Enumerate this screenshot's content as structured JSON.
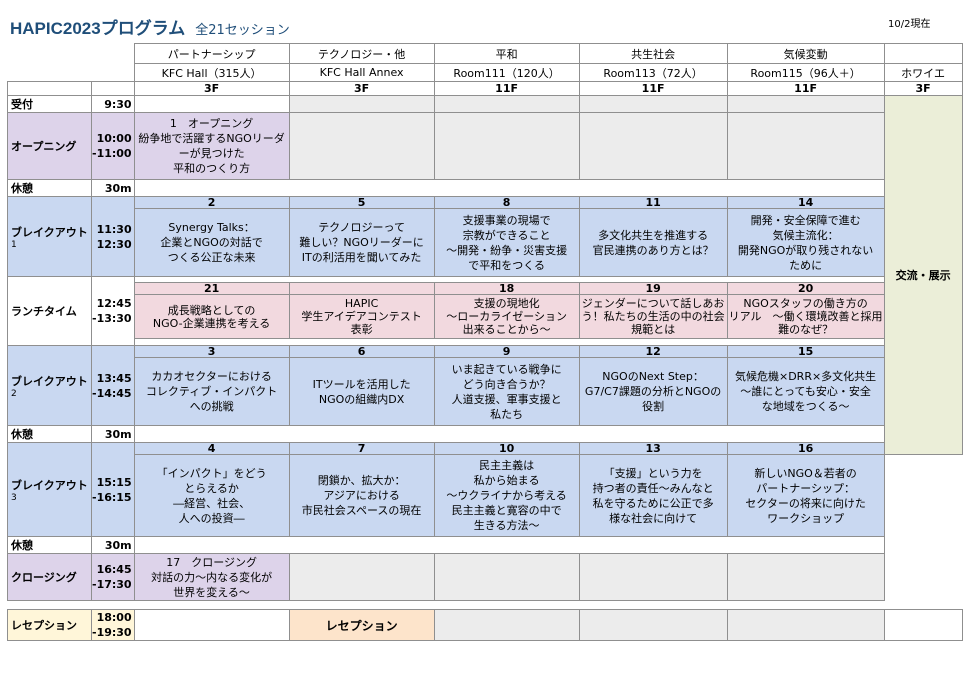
{
  "header": {
    "title": "HAPIC2023プログラム",
    "subtitle": "全21セッション",
    "as_of": "10/2現在"
  },
  "tracks": [
    {
      "name": "パートナーシップ",
      "room": "KFC Hall（315人）",
      "floor": "3F"
    },
    {
      "name": "テクノロジー・他",
      "room": "KFC Hall Annex",
      "floor": "3F"
    },
    {
      "name": "平和",
      "room": "Room111（120人）",
      "floor": "11F"
    },
    {
      "name": "共生社会",
      "room": "Room113（72人）",
      "floor": "11F"
    },
    {
      "name": "気候変動",
      "room": "Room115（96人＋）",
      "floor": "11F"
    },
    {
      "name": "",
      "room": "ホワイエ",
      "floor": "3F"
    }
  ],
  "foyer": "交流・展示",
  "rows": {
    "reception_desk": {
      "label": "受付",
      "time": "9:30"
    },
    "opening": {
      "label": "オープニング",
      "time1": "10:00",
      "time2": "-11:00",
      "session": "1　オープニング\n紛争地で活躍するNGOリーダーが見つけた\n平和のつくり方"
    },
    "break1": {
      "label": "休憩",
      "time": "30m"
    },
    "breakout1": {
      "label": "ブレイクアウト",
      "sub": "1",
      "time1": "11:30",
      "time2": "12:30",
      "sessions": [
        {
          "num": "2",
          "title": "Synergy Talks：\n企業とNGOの対話で\nつくる公正な未来"
        },
        {
          "num": "5",
          "title": "テクノロジーって\n難しい？NGOリーダーに\nITの利活用を聞いてみた"
        },
        {
          "num": "8",
          "title": "支援事業の現場で\n宗教ができること\n～開発・紛争・災害支援\nで平和をつくる"
        },
        {
          "num": "11",
          "title": "多文化共生を推進する\n官民連携のあり方とは？"
        },
        {
          "num": "14",
          "title": "開発・安全保障で進む\n気候主流化：\n開発NGOが取り残されない\nために"
        }
      ]
    },
    "lunch": {
      "label": "ランチタイム",
      "time1": "12:45",
      "time2": "-13:30",
      "sessions": [
        {
          "num": "21",
          "title": "成長戦略としての\nNGO-企業連携を考える"
        },
        {
          "num": "",
          "title": "HAPIC\n学生アイデアコンテスト\n表彰"
        },
        {
          "num": "18",
          "title": "支援の現地化\n～ローカライゼーション\n出来ることから～"
        },
        {
          "num": "19",
          "title": "ジェンダーについて話しあおう！私たちの生活の中の社会規範とは"
        },
        {
          "num": "20",
          "title": "NGOスタッフの働き方の\nリアル　～働く環境改善と採用難のなぜ？"
        }
      ]
    },
    "breakout2": {
      "label": "ブレイクアウト",
      "sub": "2",
      "time1": "13:45",
      "time2": "-14:45",
      "sessions": [
        {
          "num": "3",
          "title": "カカオセクターにおける\nコレクティブ・インパクト\nへの挑戦"
        },
        {
          "num": "6",
          "title": "ITツールを活用した\nNGOの組織内DX"
        },
        {
          "num": "9",
          "title": "いま起きている戦争に\nどう向き合うか？\n人道支援、軍事支援と\n私たち"
        },
        {
          "num": "12",
          "title": "NGOのNext Step：\nG7/C7課題の分析とNGOの\n役割"
        },
        {
          "num": "15",
          "title": "気候危機×DRR×多文化共生\n～誰にとっても安心・安全\nな地域をつくる～"
        }
      ]
    },
    "break2": {
      "label": "休憩",
      "time": "30m"
    },
    "breakout3": {
      "label": "ブレイクアウト",
      "sub": "3",
      "time1": "15:15",
      "time2": "-16:15",
      "sessions": [
        {
          "num": "4",
          "title": "「インパクト」をどう\nとらえるか\n―経営、社会、\n人への投資―"
        },
        {
          "num": "7",
          "title": "閉鎖か、拡大か：\nアジアにおける\n市民社会スペースの現在"
        },
        {
          "num": "10",
          "title": "民主主義は\n私から始まる\n～ウクライナから考える\n民主主義と寛容の中で\n生きる方法～"
        },
        {
          "num": "13",
          "title": "「支援」という力を\n持つ者の責任～みんなと\n私を守るために公正で多\n様な社会に向けて"
        },
        {
          "num": "16",
          "title": "新しいNGO＆若者の\nパートナーシップ：\nセクターの将来に向けた\nワークショップ"
        }
      ]
    },
    "break3": {
      "label": "休憩",
      "time": "30m"
    },
    "closing": {
      "label": "クロージング",
      "time1": "16:45",
      "time2": "-17:30",
      "session": "17　クロージング\n対話の力～内なる変化が\n世界を変える～"
    },
    "reception": {
      "label": "レセプション",
      "time1": "18:00",
      "time2": "-19:30",
      "venue": "レセプション"
    }
  },
  "colors": {
    "opening": "#ddd3ea",
    "breakout": "#c9d8f1",
    "lunch": "#f2d9df",
    "empty": "#ececec",
    "foyer": "#ebeed8",
    "reception": "#fde4cb"
  }
}
